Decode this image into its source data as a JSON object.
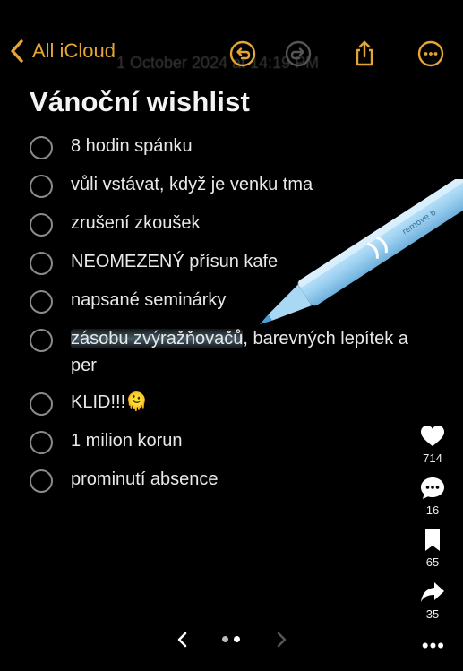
{
  "nav": {
    "back_label": "All iCloud",
    "ghost_text": "1 October 2024 at 14:19 PM",
    "accent": "#e5a536"
  },
  "note": {
    "title": "Vánoční wishlist",
    "items": [
      {
        "text": "8 hodin spánku"
      },
      {
        "text": "vůli vstávat, když je venku tma"
      },
      {
        "text": "zrušení zkoušek"
      },
      {
        "text": "NEOMEZENÝ přísun kafe"
      },
      {
        "text": "napsané seminárky"
      },
      {
        "text_highlight": "zásobu zvýražňovačů",
        "text_rest": ", barevných lepítek a per"
      },
      {
        "text": "KLID!!!🫠"
      },
      {
        "text": "1 milion korun"
      },
      {
        "text": "prominutí absence"
      }
    ]
  },
  "pen": {
    "brand": "remove b",
    "color": "#9fd2f2"
  },
  "rail": {
    "likes": "714",
    "comments": "16",
    "saves": "65",
    "shares": "35"
  },
  "icons": {
    "back": "chevron-left-icon",
    "undo": "undo-icon",
    "redo": "redo-icon",
    "share": "share-icon",
    "more": "more-icon"
  }
}
